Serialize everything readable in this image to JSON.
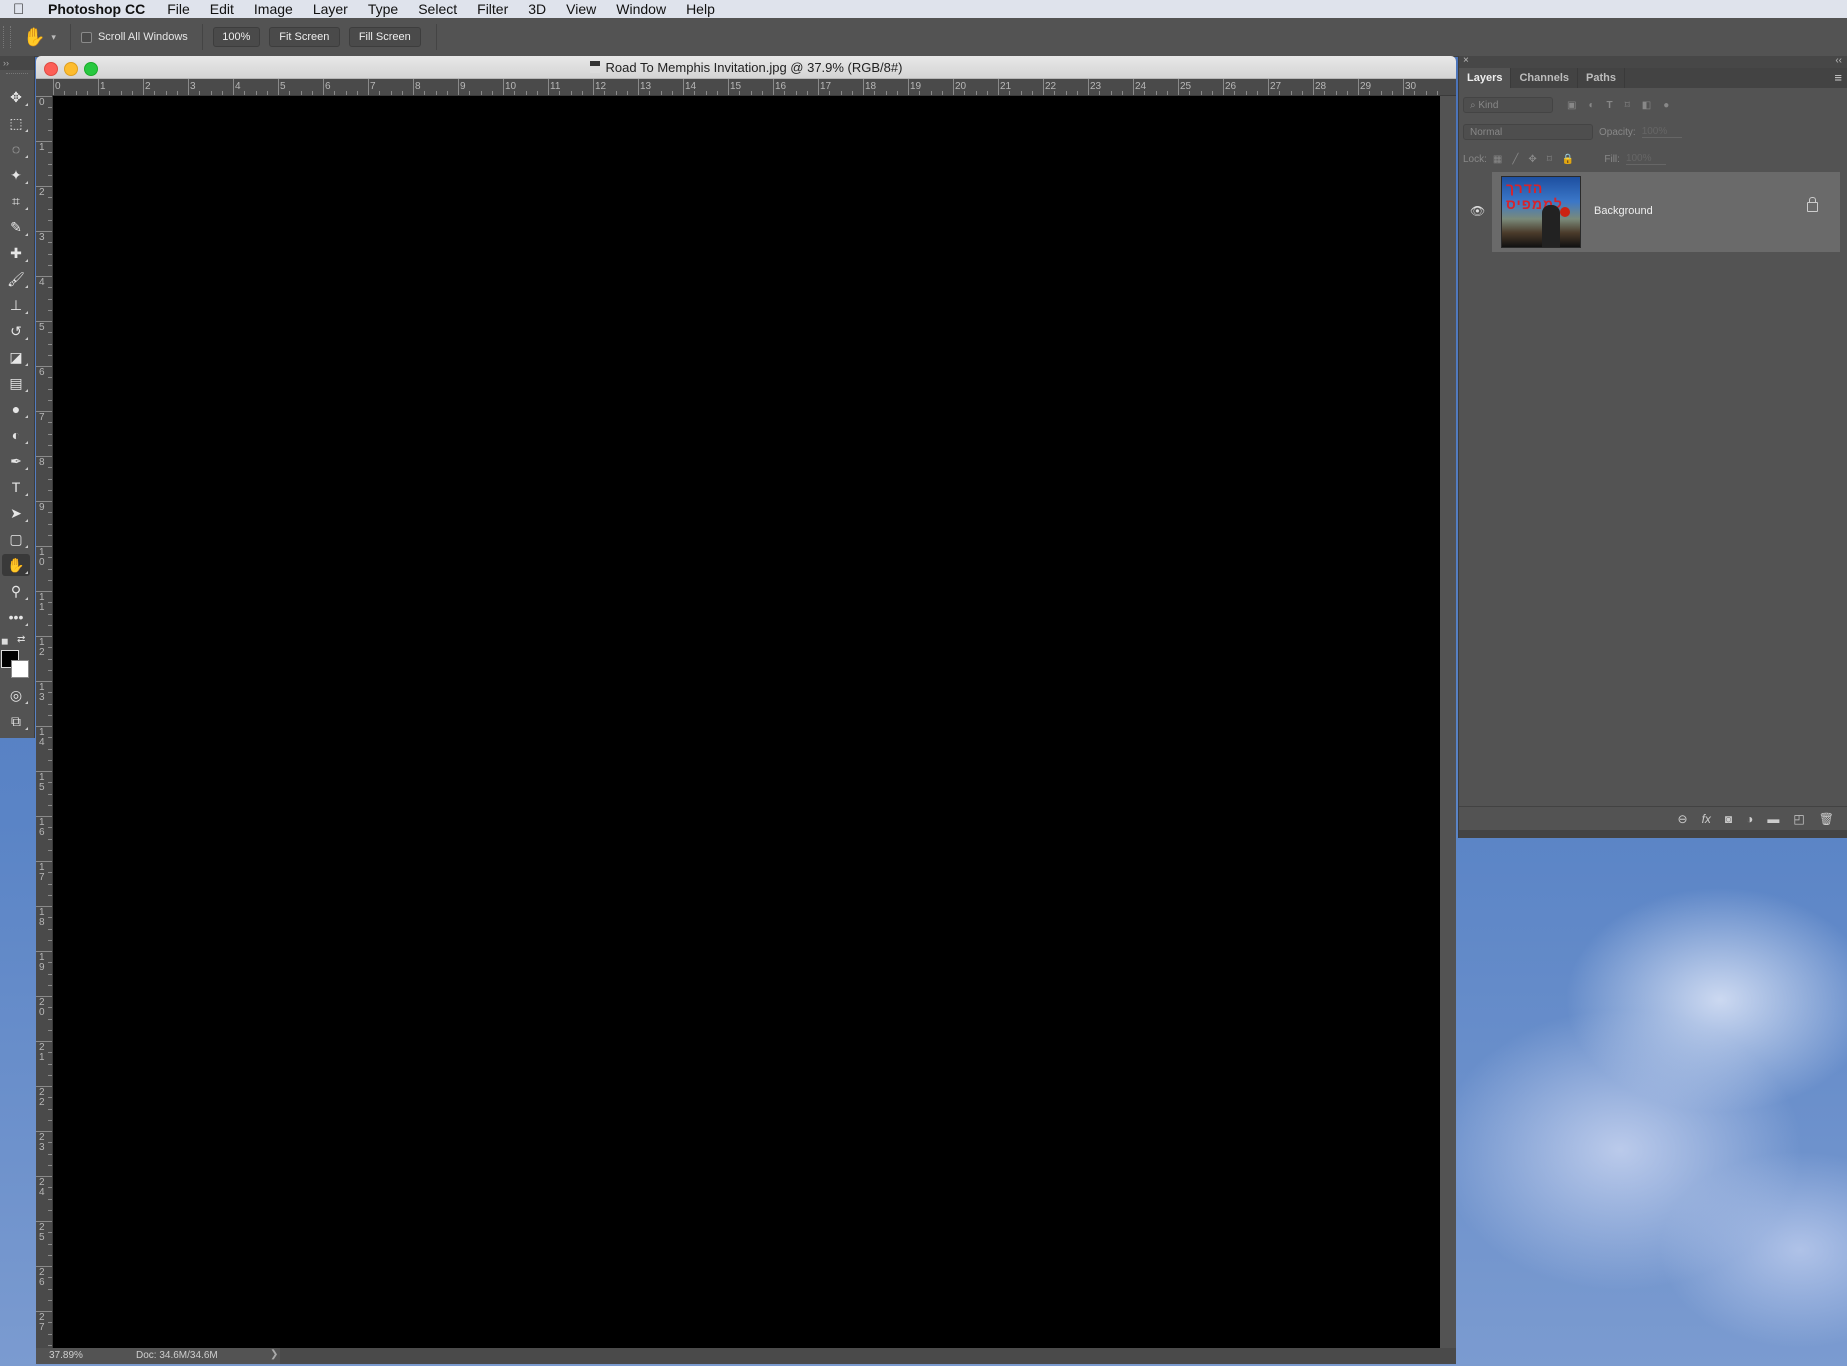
{
  "menubar": {
    "apple_icon": "apple-logo",
    "app_name": "Photoshop CC",
    "items": [
      "File",
      "Edit",
      "Image",
      "Layer",
      "Type",
      "Select",
      "Filter",
      "3D",
      "View",
      "Window",
      "Help"
    ]
  },
  "options_bar": {
    "tool_icon": "hand-icon",
    "scroll_all_windows_label": "Scroll All Windows",
    "scroll_all_windows_checked": false,
    "zoom_100_label": "100%",
    "fit_screen_label": "Fit Screen",
    "fill_screen_label": "Fill Screen"
  },
  "toolbar": {
    "tools": [
      {
        "name": "move-tool",
        "glyph": "✥"
      },
      {
        "name": "marquee-tool",
        "glyph": "⬚"
      },
      {
        "name": "lasso-tool",
        "glyph": "◌"
      },
      {
        "name": "magic-wand-tool",
        "glyph": "✦"
      },
      {
        "name": "crop-tool",
        "glyph": "⌗"
      },
      {
        "name": "eyedropper-tool",
        "glyph": "✎"
      },
      {
        "name": "healing-brush-tool",
        "glyph": "✚"
      },
      {
        "name": "brush-tool",
        "glyph": "🖌"
      },
      {
        "name": "clone-stamp-tool",
        "glyph": "⊥"
      },
      {
        "name": "history-brush-tool",
        "glyph": "↺"
      },
      {
        "name": "eraser-tool",
        "glyph": "◪"
      },
      {
        "name": "gradient-tool",
        "glyph": "▤"
      },
      {
        "name": "blur-tool",
        "glyph": "●"
      },
      {
        "name": "dodge-tool",
        "glyph": "◐"
      },
      {
        "name": "pen-tool",
        "glyph": "✒"
      },
      {
        "name": "type-tool",
        "glyph": "T"
      },
      {
        "name": "path-selection-tool",
        "glyph": "➤"
      },
      {
        "name": "rectangle-tool",
        "glyph": "▢"
      },
      {
        "name": "hand-tool",
        "glyph": "✋",
        "active": true
      },
      {
        "name": "zoom-tool",
        "glyph": "⚲"
      },
      {
        "name": "more-tools",
        "glyph": "•••"
      }
    ],
    "foreground_color": "#000000",
    "background_color": "#ffffff"
  },
  "document": {
    "title": "Road To Memphis Invitation.jpg @ 37.9% (RGB/8#)",
    "h_ruler_labels": [
      "0",
      "1",
      "2",
      "3",
      "4",
      "5",
      "6",
      "7",
      "8",
      "9",
      "10",
      "11",
      "12",
      "13",
      "14",
      "15",
      "16",
      "17",
      "18",
      "19",
      "20",
      "21",
      "22",
      "23",
      "24",
      "25",
      "26",
      "27",
      "28",
      "29",
      "30"
    ],
    "v_ruler_labels": [
      "0",
      "1",
      "2",
      "3",
      "4",
      "5",
      "6",
      "7",
      "8",
      "9",
      "10",
      "11",
      "12",
      "13",
      "14",
      "15",
      "16",
      "17",
      "18",
      "19",
      "20",
      "21",
      "22",
      "23",
      "24",
      "25",
      "26",
      "27"
    ],
    "canvas_color": "#000000",
    "status_zoom": "37.89%",
    "status_doc": "Doc: 34.6M/34.6M",
    "status_arrow": "❯"
  },
  "layers_panel": {
    "tabs": [
      "Layers",
      "Channels",
      "Paths"
    ],
    "active_tab": "Layers",
    "filter_placeholder": "Kind",
    "blend_mode": "Normal",
    "opacity_label": "Opacity:",
    "opacity_value": "100%",
    "lock_label": "Lock:",
    "fill_label": "Fill:",
    "fill_value": "100%",
    "layers": [
      {
        "name": "Background",
        "visible": true,
        "locked": true,
        "thumbnail_title": "הדרך לממפיס"
      }
    ],
    "footer_icons": [
      "link-icon",
      "fx-icon",
      "mask-icon",
      "adjustment-icon",
      "folder-icon",
      "new-layer-icon",
      "trash-icon"
    ]
  }
}
